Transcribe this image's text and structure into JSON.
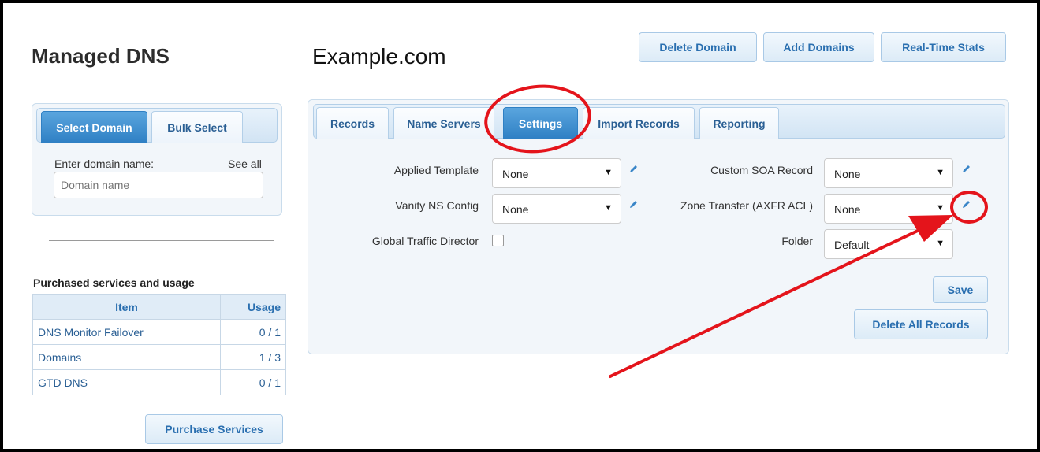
{
  "sidebar": {
    "title": "Managed DNS",
    "tabs": [
      {
        "label": "Select Domain",
        "active": true
      },
      {
        "label": "Bulk Select",
        "active": false
      }
    ],
    "domain_input_label": "Enter domain name:",
    "see_all_link": "See all",
    "domain_input_placeholder": "Domain name",
    "services_title": "Purchased services and usage",
    "table": {
      "headers": [
        "Item",
        "Usage"
      ],
      "rows": [
        {
          "item": "DNS Monitor Failover",
          "usage": "0 / 1"
        },
        {
          "item": "Domains",
          "usage": "1 / 3"
        },
        {
          "item": "GTD DNS",
          "usage": "0 / 1"
        }
      ]
    },
    "purchase_button": "Purchase Services"
  },
  "main": {
    "title": "Example.com",
    "header_buttons": [
      "Delete Domain",
      "Add Domains",
      "Real-Time Stats"
    ],
    "tabs": [
      {
        "label": "Records",
        "active": false
      },
      {
        "label": "Name Servers",
        "active": false
      },
      {
        "label": "Settings",
        "active": true
      },
      {
        "label": "Import Records",
        "active": false
      },
      {
        "label": "Reporting",
        "active": false
      }
    ],
    "settings": {
      "applied_template": {
        "label": "Applied Template",
        "value": "None"
      },
      "vanity_ns": {
        "label": "Vanity NS Config",
        "value": "None"
      },
      "gtd": {
        "label": "Global Traffic Director",
        "checked": false
      },
      "custom_soa": {
        "label": "Custom SOA Record",
        "value": "None"
      },
      "zone_transfer": {
        "label": "Zone Transfer (AXFR ACL)",
        "value": "None"
      },
      "folder": {
        "label": "Folder",
        "value": "Default"
      }
    },
    "save_button": "Save",
    "delete_all_button": "Delete All Records"
  },
  "icons": {
    "edit": "pencil-icon",
    "dropdown": "caret-down-icon"
  },
  "colors": {
    "accent": "#2f80c4",
    "annotation": "#e4141b"
  }
}
